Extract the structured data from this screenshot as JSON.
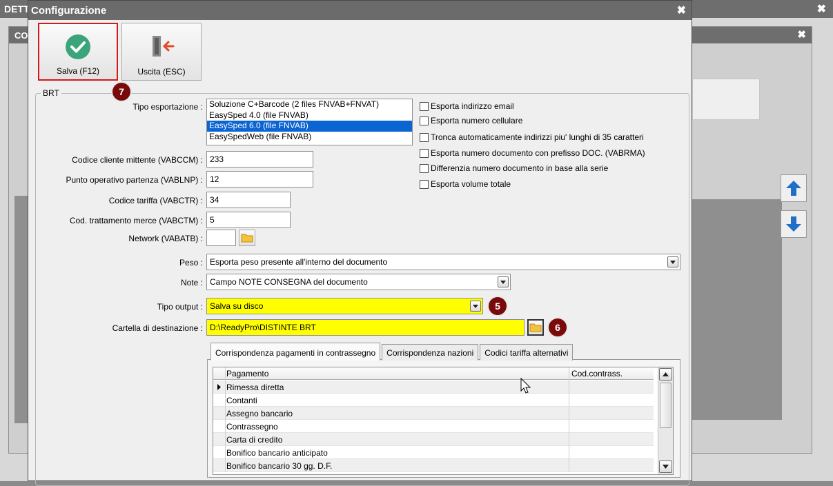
{
  "background": {
    "window_title": "DETT",
    "inner_window_title": "CO"
  },
  "dialog": {
    "title": "Configurazione",
    "close_glyph": "✖"
  },
  "toolbar": {
    "save_label": "Salva (F12)",
    "exit_label": "Uscita (ESC)"
  },
  "group": {
    "title": "BRT"
  },
  "form": {
    "tipo_esportazione_label": "Tipo esportazione :",
    "tipo_esportazione_options": [
      "Soluzione C+Barcode (2 files FNVAB+FNVAT)",
      "EasySped 4.0 (file FNVAB)",
      "EasySped 6.0 (file FNVAB)",
      "EasySpedWeb (file FNVAB)"
    ],
    "codice_cliente_label": "Codice cliente mittente (VABCCM) :",
    "codice_cliente_value": "233",
    "punto_operativo_label": "Punto operativo partenza (VABLNP) :",
    "punto_operativo_value": "12",
    "codice_tariffa_label": "Codice tariffa (VABCTR) :",
    "codice_tariffa_value": "34",
    "cod_trattamento_label": "Cod. trattamento merce (VABCTM) :",
    "cod_trattamento_value": "5",
    "network_label": "Network (VABATB) :",
    "network_value": "",
    "peso_label": "Peso :",
    "peso_value": "Esporta peso presente all'interno del documento",
    "note_label": "Note :",
    "note_value": "Campo NOTE CONSEGNA del documento",
    "tipo_output_label": "Tipo output :",
    "tipo_output_value": "Salva su disco",
    "cartella_label": "Cartella di destinazione :",
    "cartella_value": "D:\\ReadyPro\\DISTINTE BRT"
  },
  "checkboxes": [
    "Esporta indirizzo email",
    "Esporta numero cellulare",
    "Tronca automaticamente indirizzi piu' lunghi di 35 caratteri",
    "Esporta numero documento con prefisso DOC. (VABRMA)",
    "Differenzia numero documento in base alla serie",
    "Esporta volume totale"
  ],
  "badges": {
    "b7": "7",
    "b5": "5",
    "b6": "6"
  },
  "tabs": [
    "Corrispondenza pagamenti in contrassegno",
    "Corrispondenza nazioni",
    "Codici tariffa alternativi"
  ],
  "grid": {
    "columns": [
      "Pagamento",
      "Cod.contrass."
    ],
    "rows": [
      "Rimessa diretta",
      "Contanti",
      "Assegno bancario",
      "Contrassegno",
      "Carta di credito",
      "Bonifico bancario anticipato",
      "Bonifico bancario 30 gg. D.F."
    ]
  },
  "colors": {
    "highlight_yellow": "#ffff00",
    "selection_blue": "#0a64d2",
    "badge_red": "#7a0a0a",
    "save_border": "#d11b1b",
    "check_green": "#3aa57a"
  }
}
